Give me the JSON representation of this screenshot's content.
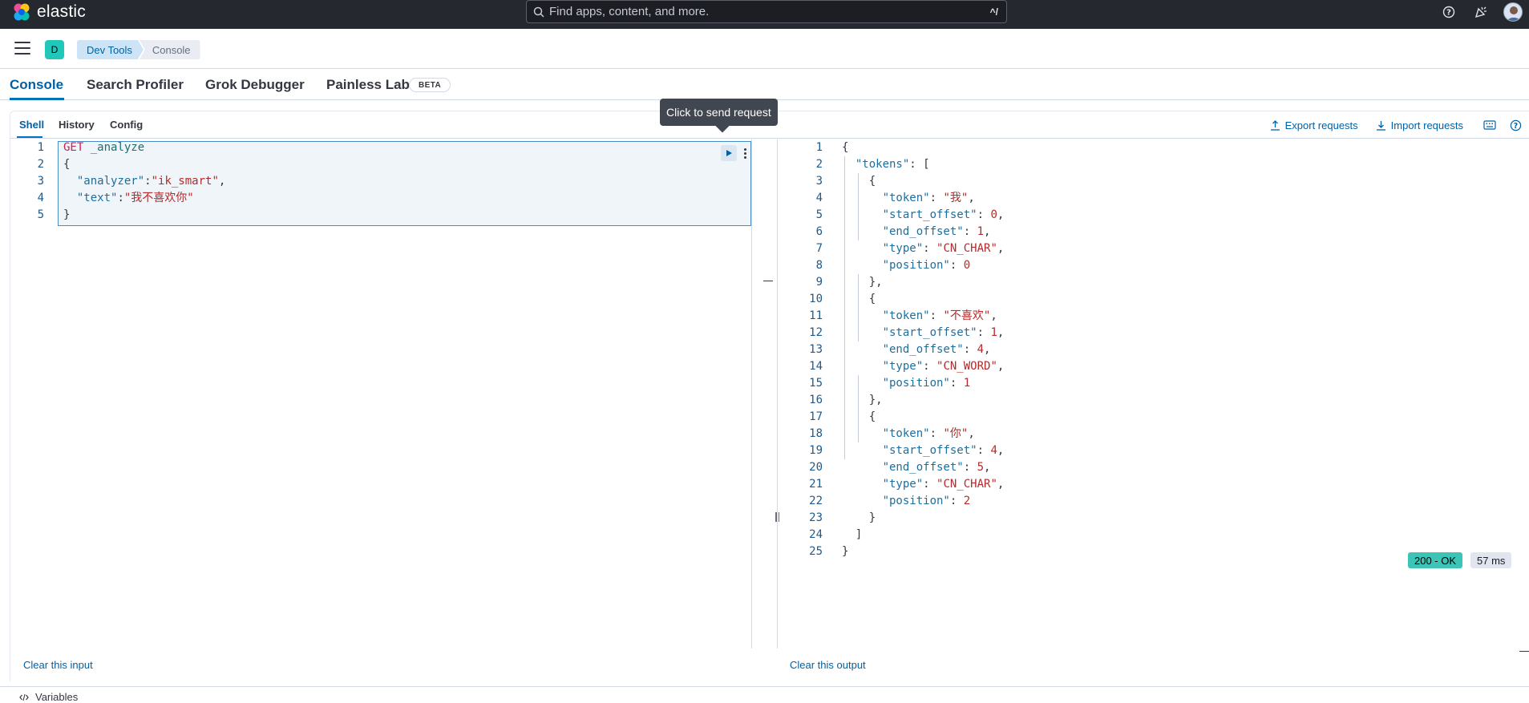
{
  "header": {
    "brand": "elastic",
    "search_placeholder": "Find apps, content, and more.",
    "search_shortcut": "^/",
    "icons": [
      "help-icon",
      "news-feed-icon",
      "user-avatar"
    ]
  },
  "breadcrumbs": {
    "space_initial": "D",
    "items": [
      "Dev Tools",
      "Console"
    ]
  },
  "app_tabs": {
    "items": [
      "Console",
      "Search Profiler",
      "Grok Debugger",
      "Painless Lab"
    ],
    "active": "Console",
    "beta_label": "BETA"
  },
  "console": {
    "subtabs": [
      "Shell",
      "History",
      "Config"
    ],
    "active_subtab": "Shell",
    "export_label": "Export requests",
    "import_label": "Import requests",
    "tooltip": "Click to send request",
    "request": {
      "method": "GET",
      "path": "_analyze",
      "analyzer_key": "\"analyzer\"",
      "analyzer_value": "\"ik_smart\"",
      "text_key": "\"text\"",
      "text_value": "\"我不喜欢你\""
    },
    "response": {
      "tokens_key": "\"tokens\"",
      "tokens": [
        {
          "token": "\"我\"",
          "start_offset": "0",
          "end_offset": "1",
          "type": "\"CN_CHAR\"",
          "position": "0"
        },
        {
          "token": "\"不喜欢\"",
          "start_offset": "1",
          "end_offset": "4",
          "type": "\"CN_WORD\"",
          "position": "1"
        },
        {
          "token": "\"你\"",
          "start_offset": "4",
          "end_offset": "5",
          "type": "\"CN_CHAR\"",
          "position": "2"
        }
      ]
    },
    "clear_input": "Clear this input",
    "clear_output": "Clear this output",
    "status": "200 - OK",
    "elapsed": "57 ms",
    "variables_label": "Variables"
  },
  "colors": {
    "header_bg": "#25282f",
    "accent": "#0061a6",
    "status_ok": "#3cc4b6"
  }
}
